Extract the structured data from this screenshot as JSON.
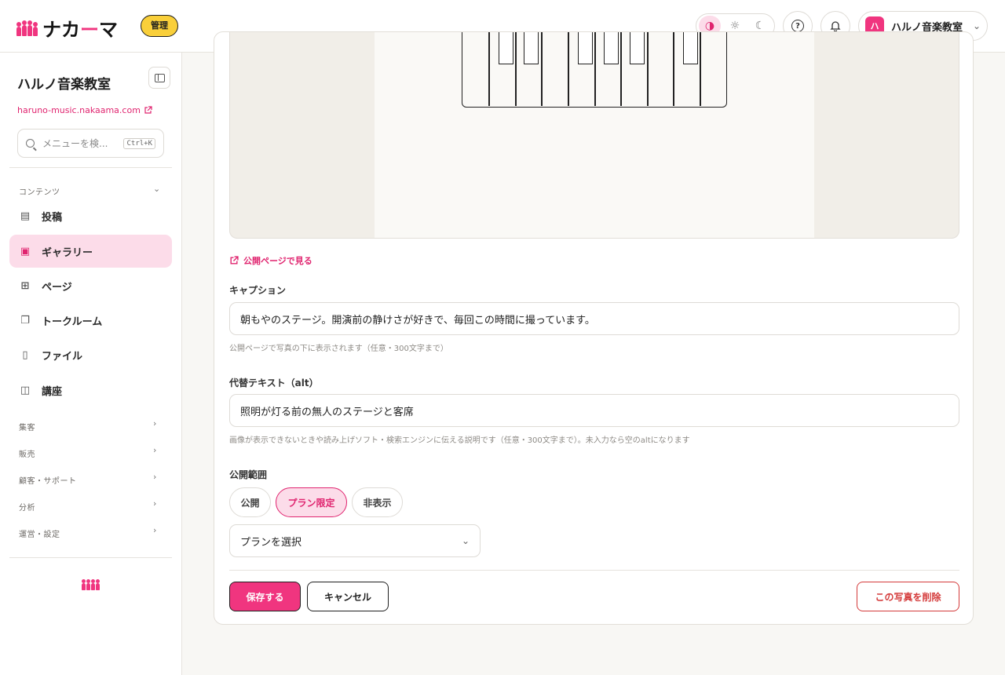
{
  "header": {
    "logo_text_a": "ナカ",
    "logo_text_b": "ー",
    "logo_text_c": "マ",
    "admin_badge": "管理",
    "account_initial": "ハ",
    "account_name": "ハルノ音楽教室"
  },
  "sidebar": {
    "site_title": "ハルノ音楽教室",
    "site_url": "haruno-music.nakaama.com",
    "search_placeholder": "メニューを検...",
    "search_shortcut": "Ctrl+K",
    "contents_label": "コンテンツ",
    "items": [
      {
        "label": "投稿",
        "icon": "document-icon"
      },
      {
        "label": "ギャラリー",
        "icon": "image-icon"
      },
      {
        "label": "ページ",
        "icon": "pages-icon"
      },
      {
        "label": "トークルーム",
        "icon": "chat-icon"
      },
      {
        "label": "ファイル",
        "icon": "file-icon"
      },
      {
        "label": "講座",
        "icon": "book-icon"
      }
    ],
    "active_item": "ギャラリー",
    "sections": [
      {
        "label": "集客"
      },
      {
        "label": "販売"
      },
      {
        "label": "顧客・サポート"
      },
      {
        "label": "分析"
      },
      {
        "label": "運営・設定"
      }
    ]
  },
  "main": {
    "view_public_link": "公開ページで見る",
    "caption_label": "キャプション",
    "caption_value": "朝もやのステージ。開演前の静けさが好きで、毎回この時間に撮っています。",
    "caption_help": "公開ページで写真の下に表示されます（任意・300文字まで）",
    "alt_label": "代替テキスト（alt）",
    "alt_value": "照明が灯る前の無人のステージと客席",
    "alt_help": "画像が表示できないときや読み上げソフト・検索エンジンに伝える説明です（任意・300文字まで）。未入力なら空のaltになります",
    "visibility_label": "公開範囲",
    "visibility_options": [
      "公開",
      "プラン限定",
      "非表示"
    ],
    "visibility_selected": "プラン限定",
    "plan_select_value": "プランを選択",
    "save_button": "保存する",
    "cancel_button": "キャンセル",
    "delete_button": "この写真を削除"
  },
  "colors": {
    "accent": "#f0357f",
    "accent_soft": "#fcdce9",
    "danger": "#d43a3a",
    "badge": "#f9cf3a"
  }
}
